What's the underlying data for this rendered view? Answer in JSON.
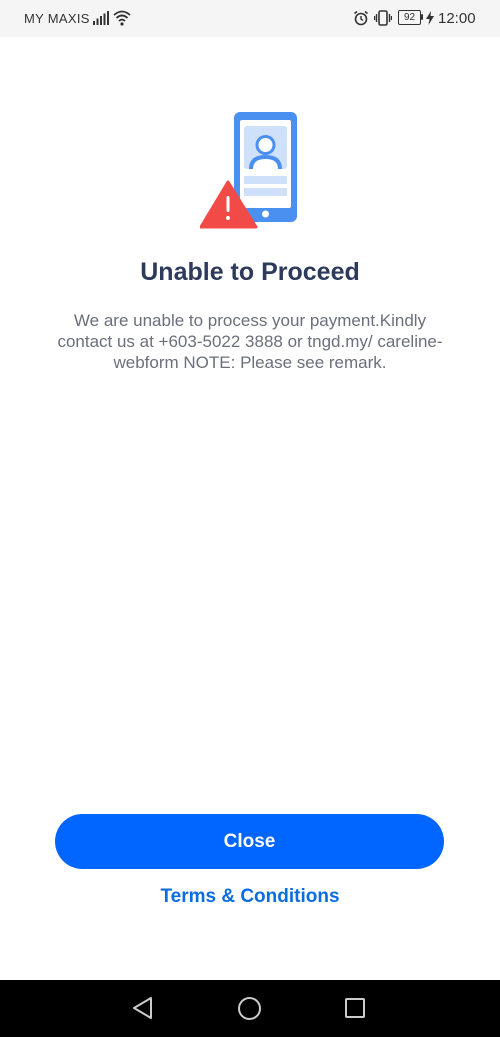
{
  "status_bar": {
    "carrier": "MY MAXIS",
    "battery_level": "92",
    "time": "12:00",
    "icons": [
      "signal-icon",
      "wifi-icon",
      "alarm-icon",
      "vibrate-icon",
      "battery-icon",
      "charging-icon"
    ]
  },
  "dialog": {
    "illustration_icon": "phone-warning-icon",
    "title": "Unable to Proceed",
    "message": "We are unable to process your payment.Kindly contact us at +603-5022 3888 or tngd.my/ careline-webform NOTE: Please see remark."
  },
  "actions": {
    "close_label": "Close",
    "terms_label": "Terms & Conditions"
  },
  "nav_bar": {
    "icons": [
      "back-icon",
      "home-icon",
      "recent-apps-icon"
    ]
  },
  "colors": {
    "primary_button": "#0066ff",
    "link": "#0a6de0",
    "title": "#2e3a5c",
    "body_text": "#6b6f7b",
    "illustration_blue": "#4a90f0",
    "warning_red": "#f24b47"
  }
}
